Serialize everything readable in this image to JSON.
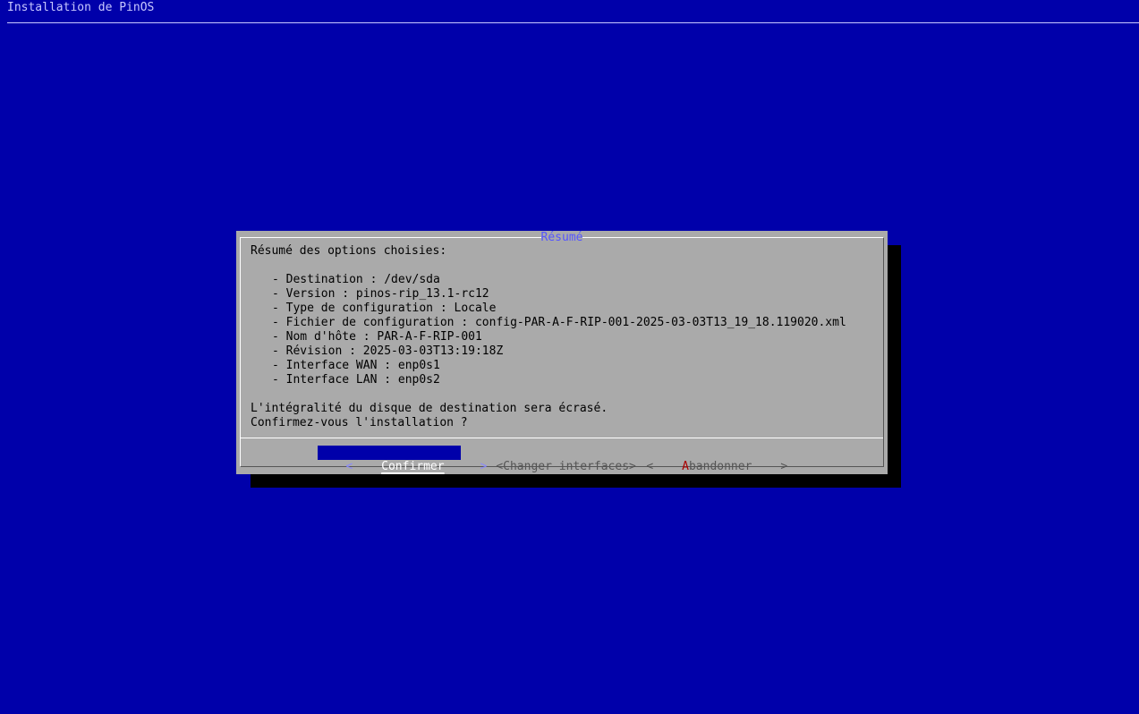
{
  "backtitle": "Installation de PinOS",
  "dialog": {
    "title": "Résumé",
    "intro": "Résumé des options choisies:",
    "items": [
      "- Destination : /dev/sda",
      "- Version : pinos-rip_13.1-rc12",
      "- Type de configuration : Locale",
      "- Fichier de configuration : config-PAR-A-F-RIP-001-2025-03-03T13_19_18.119020.xml",
      "- Nom d'hôte : PAR-A-F-RIP-001",
      "- Révision : 2025-03-03T13:19:18Z",
      "- Interface WAN : enp0s1",
      "- Interface LAN : enp0s2"
    ],
    "warning": "L'intégralité du disque de destination sera écrasé.",
    "question": "Confirmez-vous l'installation ?",
    "buttons": {
      "confirm": {
        "left": "<",
        "label": "Confirmer",
        "right": ">"
      },
      "change": {
        "left": "<",
        "label": "Changer interfaces",
        "right": ">"
      },
      "abort": {
        "left": "<",
        "hotkey": "A",
        "label": "bandonner",
        "right": ">"
      }
    }
  },
  "colors": {
    "background": "#0000aa",
    "dialog": "#aaaaaa",
    "shadow": "#000000",
    "title": "#5555ff",
    "hotkey": "#aa0000"
  }
}
